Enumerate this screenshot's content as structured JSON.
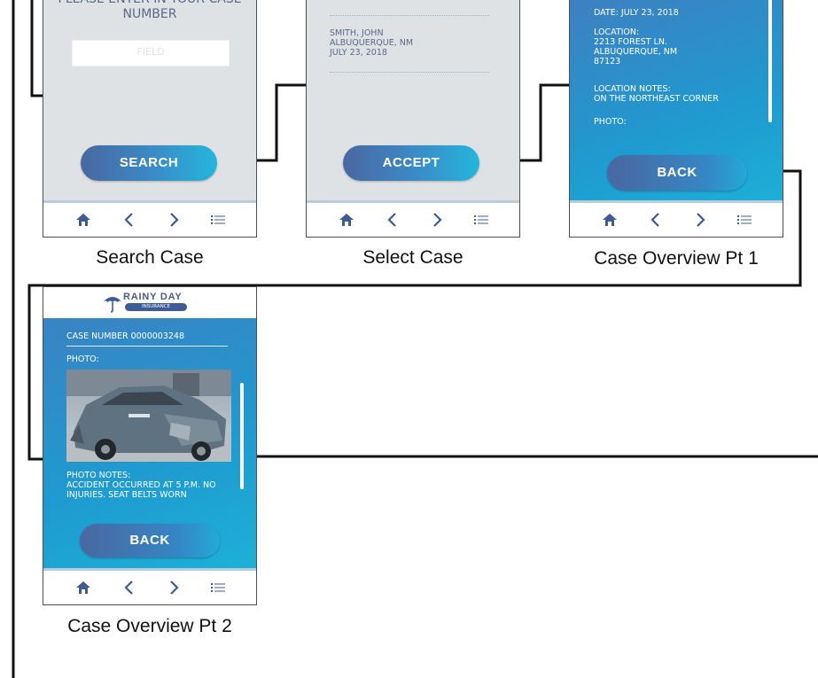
{
  "screens": {
    "search_case": {
      "caption": "Search Case",
      "prompt": "PLEASE ENTER IN\nYOUR CASE NUMBER",
      "field_placeholder": "FIELD",
      "button_label": "SEARCH"
    },
    "select_case": {
      "caption": "Select Case",
      "case_entry": "SMITH, JOHN\nALBUQUERQUE, NM\nJULY 23, 2018",
      "button_label": "ACCEPT"
    },
    "case_overview_1": {
      "caption": "Case Overview Pt 1",
      "date": "DATE: JULY 23, 2018",
      "location": "LOCATION:\n2213 FOREST LN.\nALBUQUERQUE, NM\n87123",
      "location_notes": "LOCATION NOTES:\nON THE NORTHEAST CORNER",
      "photo_label": "PHOTO:",
      "button_label": "BACK"
    },
    "case_overview_2": {
      "caption": "Case Overview Pt 2",
      "logo_name": "RAINY DAY",
      "logo_sub": "INSURANCE",
      "case_number": "CASE NUMBER 0000003248",
      "photo_label": "PHOTO:",
      "photo_notes": "PHOTO NOTES:\nACCIDENT OCCURRED AT 5 P.M.  NO\nINJURIES.  SEAT BELTS WORN",
      "button_label": "BACK"
    }
  },
  "nav_icons": [
    "home-icon",
    "chevron-left-icon",
    "chevron-right-icon",
    "menu-list-icon"
  ],
  "colors": {
    "screen_gray": "#dfe2e5",
    "screen_blue": "#1f9ad0",
    "button_start": "#4a67a1",
    "button_end": "#24b6dc",
    "nav_icon": "#3e5b95",
    "connector": "#111111"
  }
}
